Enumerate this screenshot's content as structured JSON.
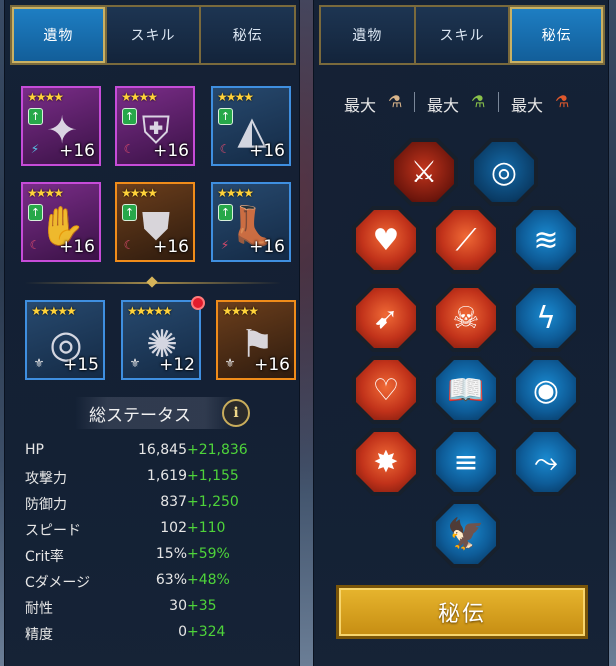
{
  "tabs": [
    "遺物",
    "スキル",
    "秘伝"
  ],
  "left_panel": {
    "active_tab": 0,
    "artifacts": [
      {
        "stars": "★★★★",
        "level": "+16",
        "rarity": "epic",
        "icon": "shuriken-icon",
        "glyph": "✦"
      },
      {
        "stars": "★★★★",
        "level": "+16",
        "rarity": "epic",
        "icon": "helmet-icon",
        "glyph": "⛨"
      },
      {
        "stars": "★★★★",
        "level": "+16",
        "rarity": "rare",
        "icon": "shoulder-armor-icon",
        "glyph": "◭"
      },
      {
        "stars": "★★★★",
        "level": "+16",
        "rarity": "epic",
        "icon": "gauntlet-icon",
        "glyph": "✋"
      },
      {
        "stars": "★★★★",
        "level": "+16",
        "rarity": "legend",
        "icon": "chest-armor-icon",
        "glyph": "⛊"
      },
      {
        "stars": "★★★★",
        "level": "+16",
        "rarity": "rare",
        "icon": "boots-icon",
        "glyph": "👢"
      }
    ],
    "accessories": [
      {
        "stars": "★★★★★",
        "level": "+15",
        "rarity": "rare",
        "icon": "ring-icon",
        "glyph": "◎"
      },
      {
        "stars": "★★★★★",
        "level": "+12",
        "rarity": "rare",
        "icon": "amulet-icon",
        "glyph": "✺",
        "notification": true
      },
      {
        "stars": "★★★★",
        "level": "+16",
        "rarity": "legend",
        "icon": "banner-icon",
        "glyph": "⚑"
      }
    ],
    "stats_title": "総ステータス",
    "info_symbol": "i",
    "stats": [
      {
        "label": "HP",
        "base": "16,845",
        "bonus": "+21,836"
      },
      {
        "label": "攻撃力",
        "base": "1,619",
        "bonus": "+1,155"
      },
      {
        "label": "防御力",
        "base": "837",
        "bonus": "+1,250"
      },
      {
        "label": "スピード",
        "base": "102",
        "bonus": "+110"
      },
      {
        "label": "Crit率",
        "base": "15%",
        "bonus": "+59%"
      },
      {
        "label": "Cダメージ",
        "base": "63%",
        "bonus": "+48%"
      },
      {
        "label": "耐性",
        "base": "30",
        "bonus": "+35"
      },
      {
        "label": "精度",
        "base": "0",
        "bonus": "+324"
      }
    ]
  },
  "right_panel": {
    "active_tab": 2,
    "max_labels": [
      "最大",
      "最大",
      "最大"
    ],
    "max_icons": [
      "bronze-scroll-icon",
      "green-scroll-icon",
      "red-scroll-icon"
    ],
    "skills": [
      {
        "icon": "blade-strike-icon",
        "color": "dark-red",
        "glyph": "⚔"
      },
      {
        "icon": "vortex-icon",
        "color": "dark-blue",
        "glyph": "◎"
      },
      {
        "icon": "demon-heart-icon",
        "color": "red",
        "glyph": "♥"
      },
      {
        "icon": "slash-claws-icon",
        "color": "red",
        "glyph": "⟋"
      },
      {
        "icon": "ice-wave-icon",
        "color": "blue",
        "glyph": "≋"
      },
      {
        "icon": "arrows-hit-icon",
        "color": "red",
        "glyph": "➹"
      },
      {
        "icon": "skull-icon",
        "color": "red",
        "glyph": "☠"
      },
      {
        "icon": "lightning-icon",
        "color": "blue",
        "glyph": "ϟ"
      },
      {
        "icon": "piercing-heart-icon",
        "color": "red",
        "glyph": "♡"
      },
      {
        "icon": "book-icon",
        "color": "blue",
        "glyph": "📖"
      },
      {
        "icon": "eye-icon",
        "color": "blue",
        "glyph": "◉"
      },
      {
        "icon": "blast-icon",
        "color": "red",
        "glyph": "✸"
      },
      {
        "icon": "speed-boot-icon",
        "color": "blue",
        "glyph": "≡"
      },
      {
        "icon": "dodge-icon",
        "color": "blue",
        "glyph": "⤳"
      },
      {
        "icon": "eagle-icon",
        "color": "blue",
        "glyph": "🦅"
      }
    ],
    "button_label": "秘伝"
  }
}
